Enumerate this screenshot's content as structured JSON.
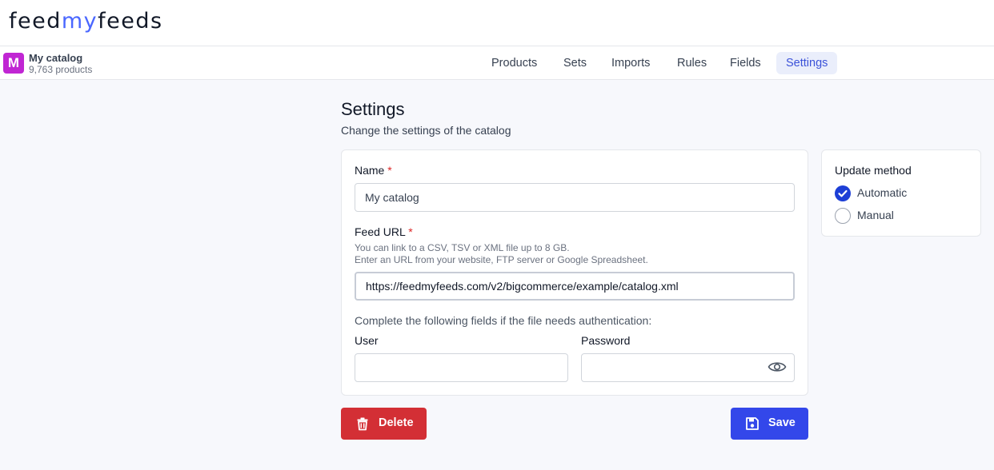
{
  "brand": {
    "part1": "feed",
    "part2": "my",
    "part3": "feeds",
    "accent_color": "#4a67ff"
  },
  "catalog": {
    "initial": "M",
    "name": "My catalog",
    "count": "9,763 products"
  },
  "nav": {
    "tabs": [
      {
        "label": "Products"
      },
      {
        "label": "Sets"
      },
      {
        "label": "Imports"
      },
      {
        "label": "Rules"
      },
      {
        "label": "Fields"
      },
      {
        "label": "Settings",
        "active": true
      }
    ]
  },
  "page": {
    "title": "Settings",
    "subtitle": "Change the settings of the catalog"
  },
  "form": {
    "name_label": "Name",
    "required_mark": "*",
    "name_value": "My catalog",
    "feed_url_label": "Feed URL",
    "feed_help_1": "You can link to a CSV, TSV or XML file up to 8 GB.",
    "feed_help_2": "Enter an URL from your website, FTP server or Google Spreadsheet.",
    "feed_url_value": "https://feedmyfeeds.com/v2/bigcommerce/example/catalog.xml",
    "auth_note": "Complete the following fields if the file needs authentication:",
    "user_label": "User",
    "user_value": "",
    "password_label": "Password",
    "password_value": ""
  },
  "update_method": {
    "title": "Update method",
    "options": [
      {
        "label": "Automatic",
        "checked": true
      },
      {
        "label": "Manual",
        "checked": false
      }
    ]
  },
  "actions": {
    "delete_label": "Delete",
    "save_label": "Save",
    "delete_color": "#d32f35",
    "save_color": "#3347ea"
  },
  "icons": [
    "eye-icon",
    "trash-icon",
    "save-icon",
    "check-icon"
  ]
}
